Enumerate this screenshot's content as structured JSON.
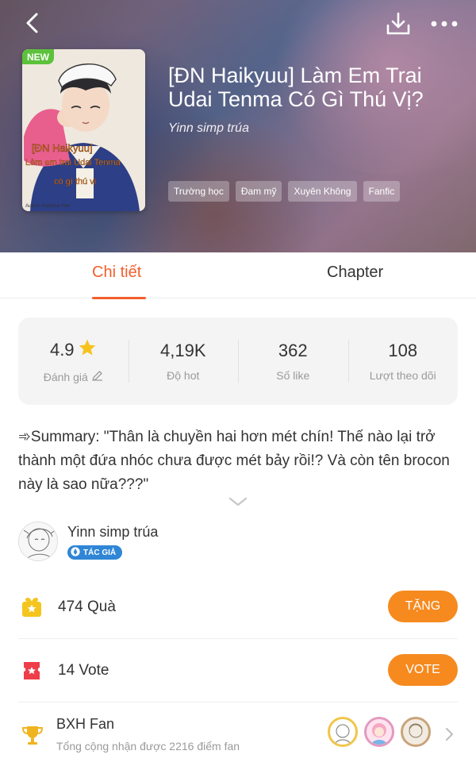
{
  "colors": {
    "accent": "#f25f2d",
    "button": "#f68a1f",
    "new_badge": "#5cc23b",
    "author_badge": "#2f86d6"
  },
  "header": {
    "new_badge": "NEW",
    "title": "[ĐN Haikyuu] Làm Em Trai Udai Tenma Có Gì Thú Vị?",
    "author": "Yinn simp trúa",
    "tags": [
      "Trường học",
      "Đam mỹ",
      "Xuyên Không",
      "Fanfic"
    ],
    "cover_text": [
      "[ĐN Haikyuu]",
      "Làm em trai Udai Tenma",
      "có gì thú vị"
    ],
    "cover_credit": "Author: Kazuma Yinn"
  },
  "tabs": {
    "detail": "Chi tiết",
    "chapter": "Chapter",
    "active": "detail"
  },
  "stats": [
    {
      "value": "4.9",
      "label": "Đánh giá",
      "icon": "star-icon"
    },
    {
      "value": "4,19K",
      "label": "Độ hot"
    },
    {
      "value": "362",
      "label": "Số like"
    },
    {
      "value": "108",
      "label": "Lượt theo dõi"
    }
  ],
  "summary": "➾Summary: \"Thân là chuyền hai hơn mét chín! Thế nào lại trở thành một đứa nhóc chưa được mét bảy rồi!? Và còn tên brocon này là sao nữa???\"",
  "author_section": {
    "name": "Yinn simp trúa",
    "badge": "TÁC GIẢ"
  },
  "gift": {
    "count_text": "474 Quà",
    "button": "TẶNG"
  },
  "vote": {
    "count_text": "14 Vote",
    "button": "VOTE"
  },
  "fan_ranking": {
    "title": "BXH Fan",
    "subtitle": "Tổng cộng nhận được 2216 điểm fan"
  }
}
